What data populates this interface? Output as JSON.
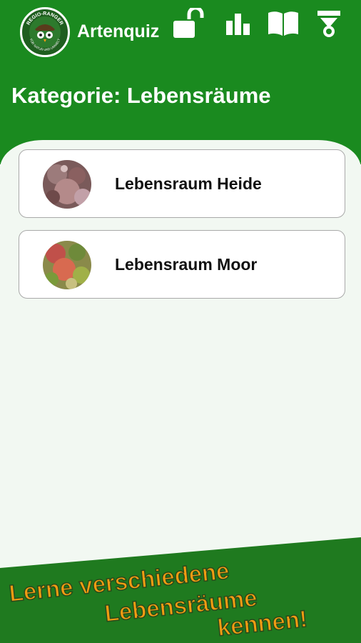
{
  "app": {
    "title": "Artenquiz",
    "logo_text_top": "REGIO-RANGER",
    "logo_text_bottom": "FÜR NATUR UND UMWELT"
  },
  "header": {
    "page_title": "Kategorie: Lebensräume",
    "icons": [
      "unlock-icon",
      "bar-chart-icon",
      "book-icon",
      "badge-icon"
    ]
  },
  "categories": [
    {
      "label": "Lebensraum Heide",
      "thumb": "heide-thumbnail"
    },
    {
      "label": "Lebensraum Moor",
      "thumb": "moor-thumbnail"
    }
  ],
  "banner": {
    "line1": "Lerne verschiedene",
    "line2": "Lebensräume",
    "line3": "kennen!"
  },
  "colors": {
    "brand_green": "#1a8a1f",
    "banner_green": "#1f7a1f",
    "banner_text": "#f39c12",
    "content_bg": "#f2f8f2"
  }
}
